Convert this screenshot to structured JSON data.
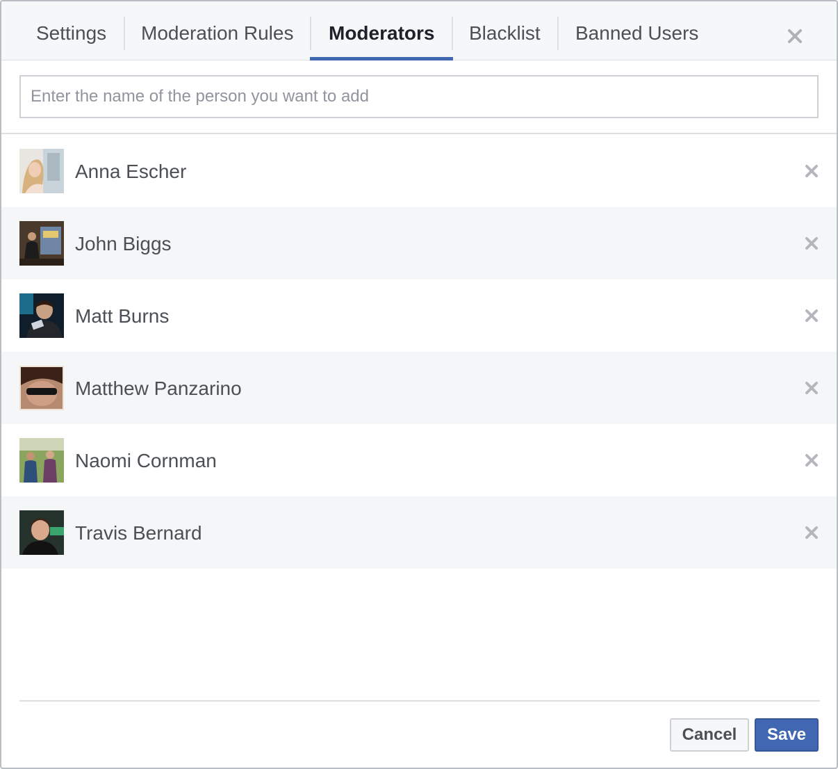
{
  "tabs": [
    {
      "label": "Settings",
      "active": false
    },
    {
      "label": "Moderation Rules",
      "active": false
    },
    {
      "label": "Moderators",
      "active": true
    },
    {
      "label": "Blacklist",
      "active": false
    },
    {
      "label": "Banned Users",
      "active": false
    }
  ],
  "close_icon": "close-icon",
  "search": {
    "placeholder": "Enter the name of the person you want to add",
    "value": ""
  },
  "moderators": [
    {
      "name": "Anna Escher",
      "avatar": "profile-photo",
      "remove_icon": "close-icon"
    },
    {
      "name": "John Biggs",
      "avatar": "profile-photo",
      "remove_icon": "close-icon"
    },
    {
      "name": "Matt Burns",
      "avatar": "profile-photo",
      "remove_icon": "close-icon"
    },
    {
      "name": "Matthew Panzarino",
      "avatar": "profile-photo",
      "remove_icon": "close-icon"
    },
    {
      "name": "Naomi Cornman",
      "avatar": "profile-photo",
      "remove_icon": "close-icon"
    },
    {
      "name": "Travis Bernard",
      "avatar": "profile-photo",
      "remove_icon": "close-icon"
    }
  ],
  "footer": {
    "cancel_label": "Cancel",
    "save_label": "Save"
  },
  "colors": {
    "accent": "#4267b2",
    "text": "#4b4f56",
    "active_text": "#1d2129",
    "row_alt": "#f5f6f7",
    "divider": "#dddfe2"
  }
}
